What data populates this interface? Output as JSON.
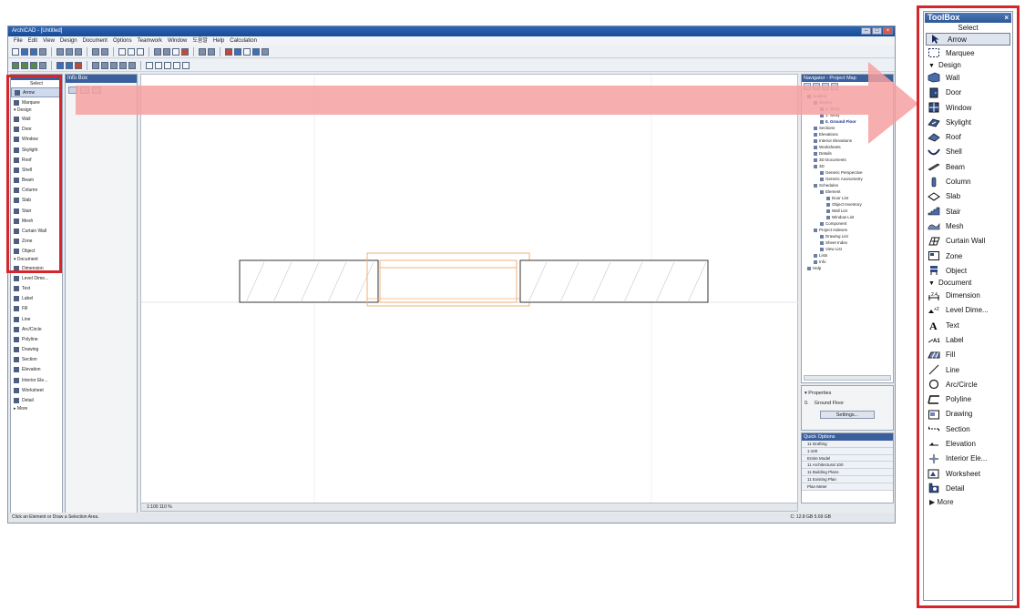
{
  "app": {
    "title": "ArchiCAD - [Untitled]",
    "menus": [
      "File",
      "Edit",
      "View",
      "Design",
      "Document",
      "Options",
      "Teamwork",
      "Window",
      "도움말",
      "Help",
      "Calculation"
    ],
    "status_text": "Click an Element or Draw a Selection Area.",
    "status_right": "C: 12.8 GB   5.69 GB",
    "scale_bar": "1:100   110 %"
  },
  "mini_toolbox": {
    "select": "Select",
    "arrow": "Arrow",
    "marquee": "Marquee",
    "design": "Design",
    "design_items": [
      "Wall",
      "Door",
      "Window",
      "Skylight",
      "Roof",
      "Shell",
      "Beam",
      "Column",
      "Slab",
      "Stair",
      "Mesh",
      "Curtain Wall",
      "Zone",
      "Object"
    ],
    "document": "Document",
    "document_items": [
      "Dimension",
      "Level Dime...",
      "Text",
      "Label",
      "Fill",
      "Line",
      "Arc/Circle",
      "Polyline",
      "Drawing",
      "Section",
      "Elevation",
      "Interior Ele...",
      "Worksheet",
      "Detail"
    ],
    "more": "More"
  },
  "infobox": {
    "title": "Info Box"
  },
  "navigator": {
    "title": "Navigator - Project Map",
    "tree": [
      "Untitled",
      "Stories",
      "2. Story",
      "1. Story",
      "0. Ground Floor",
      "Sections",
      "Elevations",
      "Interior Elevations",
      "Worksheets",
      "Details",
      "3D Documents",
      "3D",
      "Generic Perspective",
      "Generic Axonometry",
      "Schedules",
      "Element",
      "Door List",
      "Object Inventory",
      "Wall List",
      "Window List",
      "Component",
      "Project Indexes",
      "Drawing List",
      "Sheet Index",
      "View List",
      "Lists",
      "Info",
      "Help"
    ],
    "highlight_index": 4
  },
  "properties": {
    "header": "Properties",
    "floor_code": "0.",
    "floor_name": "Ground Floor",
    "settings": "Settings..."
  },
  "quick_options": {
    "title": "Quick Options",
    "rows": [
      "11 Drafting",
      "1:100",
      "Entire Model",
      "11 Architectural 100",
      "11 Building Plans",
      "11 Existing Plan",
      "Plan Meter"
    ]
  },
  "toolbox": {
    "title": "ToolBox",
    "close": "×",
    "select": "Select",
    "arrow": "Arrow",
    "marquee": "Marquee",
    "design": "Design",
    "design_items": [
      {
        "label": "Wall",
        "icon": "wall-icon"
      },
      {
        "label": "Door",
        "icon": "door-icon"
      },
      {
        "label": "Window",
        "icon": "window-icon"
      },
      {
        "label": "Skylight",
        "icon": "skylight-icon"
      },
      {
        "label": "Roof",
        "icon": "roof-icon"
      },
      {
        "label": "Shell",
        "icon": "shell-icon"
      },
      {
        "label": "Beam",
        "icon": "beam-icon"
      },
      {
        "label": "Column",
        "icon": "column-icon"
      },
      {
        "label": "Slab",
        "icon": "slab-icon"
      },
      {
        "label": "Stair",
        "icon": "stair-icon"
      },
      {
        "label": "Mesh",
        "icon": "mesh-icon"
      },
      {
        "label": "Curtain Wall",
        "icon": "curtain-wall-icon"
      },
      {
        "label": "Zone",
        "icon": "zone-icon"
      },
      {
        "label": "Object",
        "icon": "object-icon"
      }
    ],
    "document": "Document",
    "document_items": [
      {
        "label": "Dimension",
        "icon": "dimension-icon"
      },
      {
        "label": "Level Dime...",
        "icon": "level-dimension-icon"
      },
      {
        "label": "Text",
        "icon": "text-icon"
      },
      {
        "label": "Label",
        "icon": "label-icon"
      },
      {
        "label": "Fill",
        "icon": "fill-icon"
      },
      {
        "label": "Line",
        "icon": "line-icon"
      },
      {
        "label": "Arc/Circle",
        "icon": "arc-circle-icon"
      },
      {
        "label": "Polyline",
        "icon": "polyline-icon"
      },
      {
        "label": "Drawing",
        "icon": "drawing-icon"
      },
      {
        "label": "Section",
        "icon": "section-icon"
      },
      {
        "label": "Elevation",
        "icon": "elevation-icon"
      },
      {
        "label": "Interior Ele...",
        "icon": "interior-elevation-icon"
      },
      {
        "label": "Worksheet",
        "icon": "worksheet-icon"
      },
      {
        "label": "Detail",
        "icon": "detail-icon"
      }
    ],
    "more": "More"
  },
  "colors": {
    "highlight_red": "#d6262b",
    "arrow_pink": "#f5a0a0",
    "title_blue": "#2c5796"
  }
}
